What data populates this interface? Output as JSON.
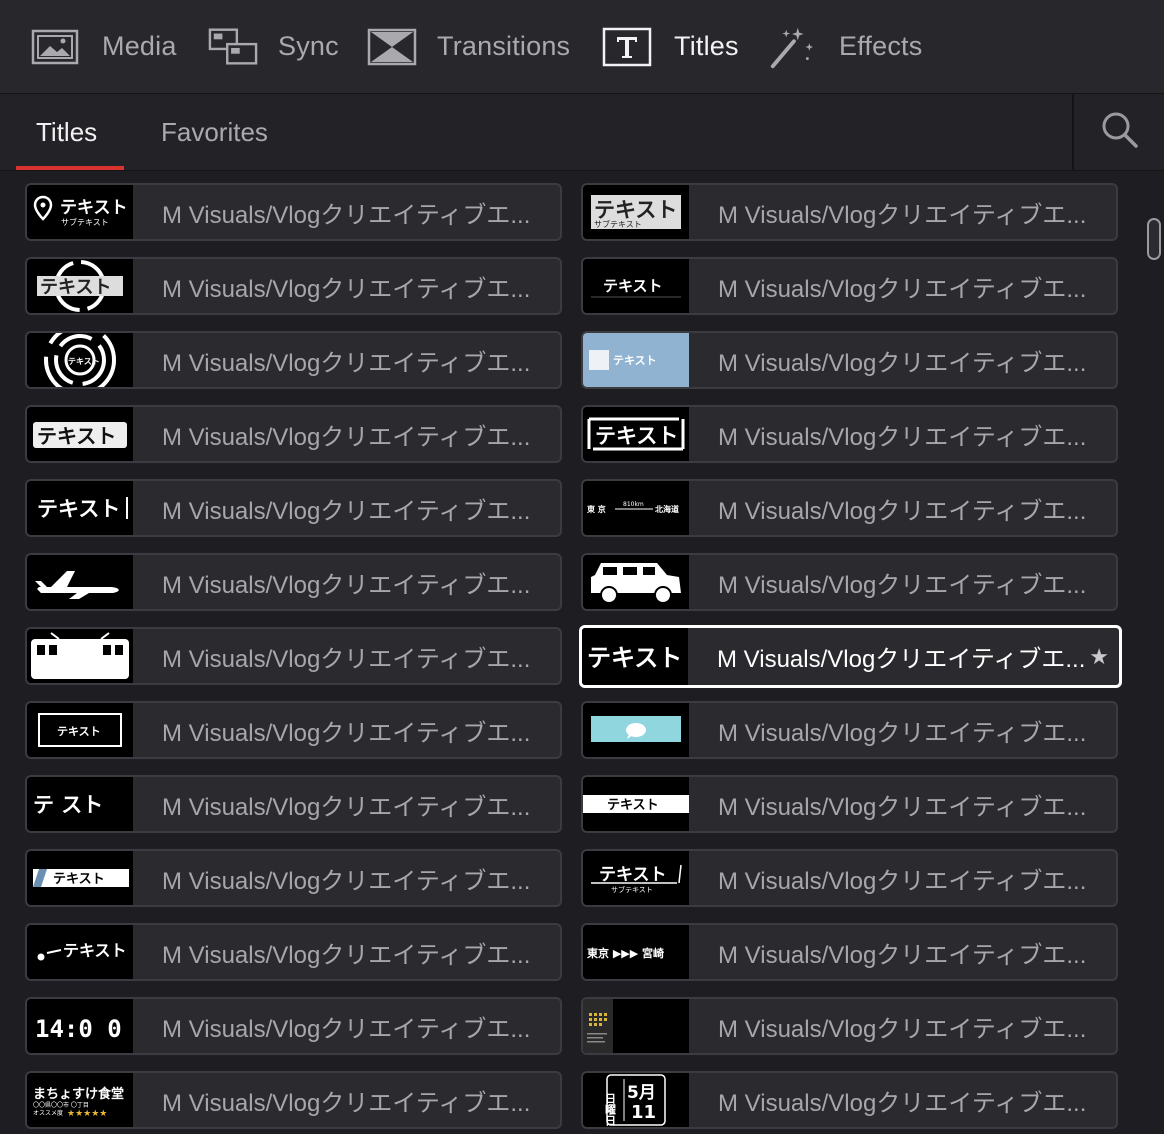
{
  "toolbar": {
    "items": [
      {
        "label": "Media",
        "icon": "media-icon"
      },
      {
        "label": "Sync",
        "icon": "sync-icon"
      },
      {
        "label": "Transitions",
        "icon": "transitions-icon"
      },
      {
        "label": "Titles",
        "icon": "titles-icon",
        "active": true
      },
      {
        "label": "Effects",
        "icon": "effects-wand-icon"
      }
    ]
  },
  "subtabs": {
    "items": [
      {
        "label": "Titles",
        "active": true
      },
      {
        "label": "Favorites"
      }
    ],
    "search_icon": "search-icon"
  },
  "titles": {
    "item_label": "M Visuals/Vlogクリエイティブエ...",
    "thumbnails": [
      {
        "text": "テキスト",
        "sub": "サブテキスト"
      },
      {
        "text": "テキスト",
        "sub": "サブテキスト"
      },
      {
        "text": "テキスト"
      },
      {
        "text": "テキスト"
      },
      {
        "text": "テキスト"
      },
      {
        "text": "テキスト"
      },
      {
        "text": "テキスト"
      },
      {
        "text": "テキスト"
      },
      {
        "text": "テキスト"
      },
      {
        "text": "東 京",
        "sub": "810km",
        "text2": "北海道"
      },
      {
        "icon": "airplane-icon"
      },
      {
        "icon": "car-icon"
      },
      {
        "icon": "train-icon"
      },
      {
        "text": "テキスト"
      },
      {
        "text": "テキスト"
      },
      {
        "icon": "speech-bubble-icon"
      },
      {
        "text": "テ スト"
      },
      {
        "text": "テキスト"
      },
      {
        "text": "テキスト"
      },
      {
        "text": "テキスト",
        "sub": "サブテキスト"
      },
      {
        "text": "テキスト"
      },
      {
        "text": "東京 ▶▶▶ 宮崎"
      },
      {
        "text": "14:0 0"
      },
      {
        "icon": "dots-grid-icon"
      },
      {
        "text": "まちょすけ食堂",
        "sub": "〇〇県〇〇市 〇丁目",
        "text2": "オススメ度"
      },
      {
        "text": "5月",
        "sub": "日曜日",
        "text2": "11"
      }
    ],
    "selected_index": 13,
    "selected_badge_icon": "favorite-star-icon"
  },
  "scrollbar": {
    "icon": "scrollbar-thumb"
  }
}
